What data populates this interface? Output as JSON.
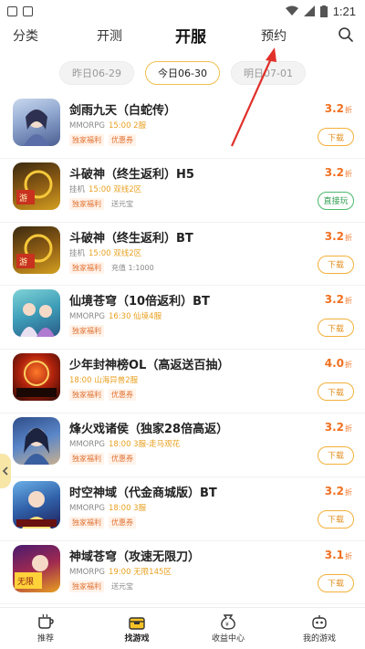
{
  "status_bar": {
    "time": "1:21"
  },
  "tabs": [
    {
      "label": "分类"
    },
    {
      "label": "开测"
    },
    {
      "label": "开服"
    },
    {
      "label": "预约"
    }
  ],
  "dates": [
    {
      "label": "昨日06-29"
    },
    {
      "label": "今日06-30"
    },
    {
      "label": "明日07-01"
    }
  ],
  "games": [
    {
      "name": "剑雨九天（白蛇传）",
      "genre": "MMORPG",
      "time": "15:00 2服",
      "tags": [
        "独家福利",
        "优惠券"
      ],
      "discount": "3.2",
      "unit": "折",
      "action": "下载"
    },
    {
      "name": "斗破神（终生返利）H5",
      "genre": "挂机",
      "time": "15:00 双线2区",
      "tags": [
        "独家福利",
        "送元宝"
      ],
      "discount": "3.2",
      "unit": "折",
      "action": "直接玩"
    },
    {
      "name": "斗破神（终生返利）BT",
      "genre": "挂机",
      "time": "15:00 双线2区",
      "tags": [
        "独家福利",
        "充值 1:1000"
      ],
      "discount": "3.2",
      "unit": "折",
      "action": "下载"
    },
    {
      "name": "仙境苍穹（10倍返利）BT",
      "genre": "MMORPG",
      "time": "16:30 仙境4服",
      "tags": [
        "独家福利"
      ],
      "discount": "3.2",
      "unit": "折",
      "action": "下载"
    },
    {
      "name": "少年封神榜OL（高返送百抽）",
      "genre": "",
      "time": "18:00 山海异兽2服",
      "tags": [
        "独家福利",
        "优惠券"
      ],
      "discount": "4.0",
      "unit": "折",
      "action": "下载"
    },
    {
      "name": "烽火戏诸侯（独家28倍高返）",
      "genre": "MMORPG",
      "time": "18:00 3服-走马观花",
      "tags": [
        "独家福利",
        "优惠券"
      ],
      "discount": "3.2",
      "unit": "折",
      "action": "下载"
    },
    {
      "name": "时空神域（代金商城版）BT",
      "genre": "MMORPG",
      "time": "18:00 3服",
      "tags": [
        "独家福利",
        "优惠券"
      ],
      "discount": "3.2",
      "unit": "折",
      "action": "下载"
    },
    {
      "name": "神域苍穹（攻速无限刀）",
      "genre": "MMORPG",
      "time": "19:00 无限145区",
      "tags": [
        "独家福利",
        "送元宝"
      ],
      "discount": "3.1",
      "unit": "折",
      "action": "下载"
    }
  ],
  "bottom_nav": [
    {
      "label": "推荐",
      "icon": "cup-icon"
    },
    {
      "label": "找游戏",
      "icon": "gift-box-icon"
    },
    {
      "label": "收益中心",
      "icon": "money-bag-icon"
    },
    {
      "label": "我的游戏",
      "icon": "robot-icon"
    }
  ],
  "colors": {
    "accent": "#f7c325",
    "discount": "#f07020",
    "tag": "#e07030",
    "green": "#35a055"
  }
}
